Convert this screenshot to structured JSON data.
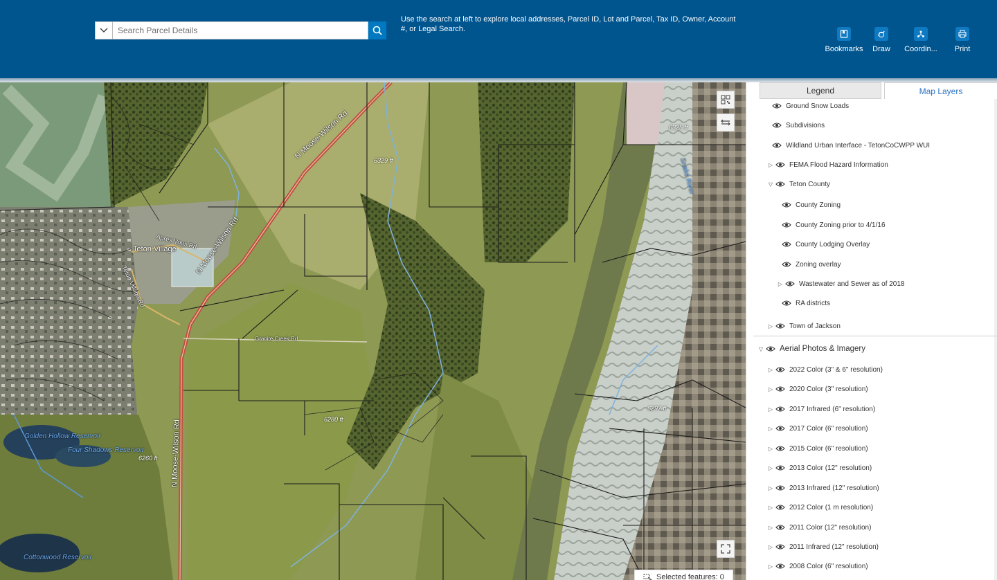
{
  "header": {
    "search_placeholder": "Search Parcel Details",
    "search_help": "Use the search at left to explore local addresses, Parcel ID, Lot and Parcel, Tax ID, Owner,  Account #, or Legal Search.",
    "tools": [
      {
        "label": "Bookmarks",
        "icon": "bookmark-icon"
      },
      {
        "label": "Draw",
        "icon": "draw-icon"
      },
      {
        "label": "Coordin...",
        "icon": "coordinates-icon"
      },
      {
        "label": "Print",
        "icon": "print-icon"
      }
    ]
  },
  "map": {
    "roads": {
      "n_moose_wilson_1": "N Moose-Wilson Rd",
      "n_moose_wilson_2": "N Moose-Wilson Rd",
      "n_moose_wilson_3": "N Moose-Wilson Rd",
      "teton_village_rd": "Teton Village Rd",
      "apres_vous_rd": "Apres Vous Rd",
      "granite_creek_rd": "Granite Creek Rd"
    },
    "places": {
      "teton_village": "Teton Village"
    },
    "elevations": [
      "6329 ft",
      "6325 ft",
      "6280 ft",
      "6297 ft",
      "6260 ft"
    ],
    "water": {
      "reservoir_1": "Golden Hollow Reservoir",
      "reservoir_2": "Four Shadows Reservoir",
      "cottonwood": "Cottonwood Reservoir",
      "snake_river": "Snake River"
    },
    "selected_features": "Selected features: 0"
  },
  "panel": {
    "tabs": {
      "legend": "Legend",
      "layers": "Map Layers"
    },
    "layers": [
      {
        "label": "Ground Snow Loads",
        "expandable": false
      },
      {
        "label": "Subdivisions",
        "expandable": false
      },
      {
        "label": "Wildland Urban Interface - TetonCoCWPP WUI",
        "expandable": false
      },
      {
        "label": "FEMA Flood Hazard Information",
        "expandable": true,
        "expanded": false
      },
      {
        "label": "Teton County",
        "expandable": true,
        "expanded": true
      },
      {
        "label": "County Zoning",
        "expandable": false
      },
      {
        "label": "County Zoning prior to 4/1/16",
        "expandable": false
      },
      {
        "label": "County Lodging Overlay",
        "expandable": false
      },
      {
        "label": "Zoning overlay",
        "expandable": false
      },
      {
        "label": "Wastewater and Sewer as of 2018",
        "expandable": true,
        "expanded": false
      },
      {
        "label": "RA districts",
        "expandable": false
      },
      {
        "label": "Town of Jackson",
        "expandable": true,
        "expanded": false
      },
      {
        "label": "Aerial Photos & Imagery",
        "expandable": true,
        "expanded": true
      },
      {
        "label": "2022 Color (3\" & 6\" resolution)",
        "expandable": true,
        "expanded": false
      },
      {
        "label": "2020 Color (3\" resolution)",
        "expandable": true,
        "expanded": false
      },
      {
        "label": "2017 Infrared (6\" resolution)",
        "expandable": true,
        "expanded": false
      },
      {
        "label": "2017 Color (6\" resolution)",
        "expandable": true,
        "expanded": false
      },
      {
        "label": "2015 Color (6\" resolution)",
        "expandable": true,
        "expanded": false
      },
      {
        "label": "2013 Color (12\" resolution)",
        "expandable": true,
        "expanded": false
      },
      {
        "label": "2013 Infrared (12\" resolution)",
        "expandable": true,
        "expanded": false
      },
      {
        "label": "2012 Color (1 m resolution)",
        "expandable": true,
        "expanded": false
      },
      {
        "label": "2011 Color (12\" resolution)",
        "expandable": true,
        "expanded": false
      },
      {
        "label": "2011 Infrared (12\" resolution)",
        "expandable": true,
        "expanded": false
      },
      {
        "label": "2008 Color (6\" resolution)",
        "expandable": true,
        "expanded": false
      }
    ]
  }
}
